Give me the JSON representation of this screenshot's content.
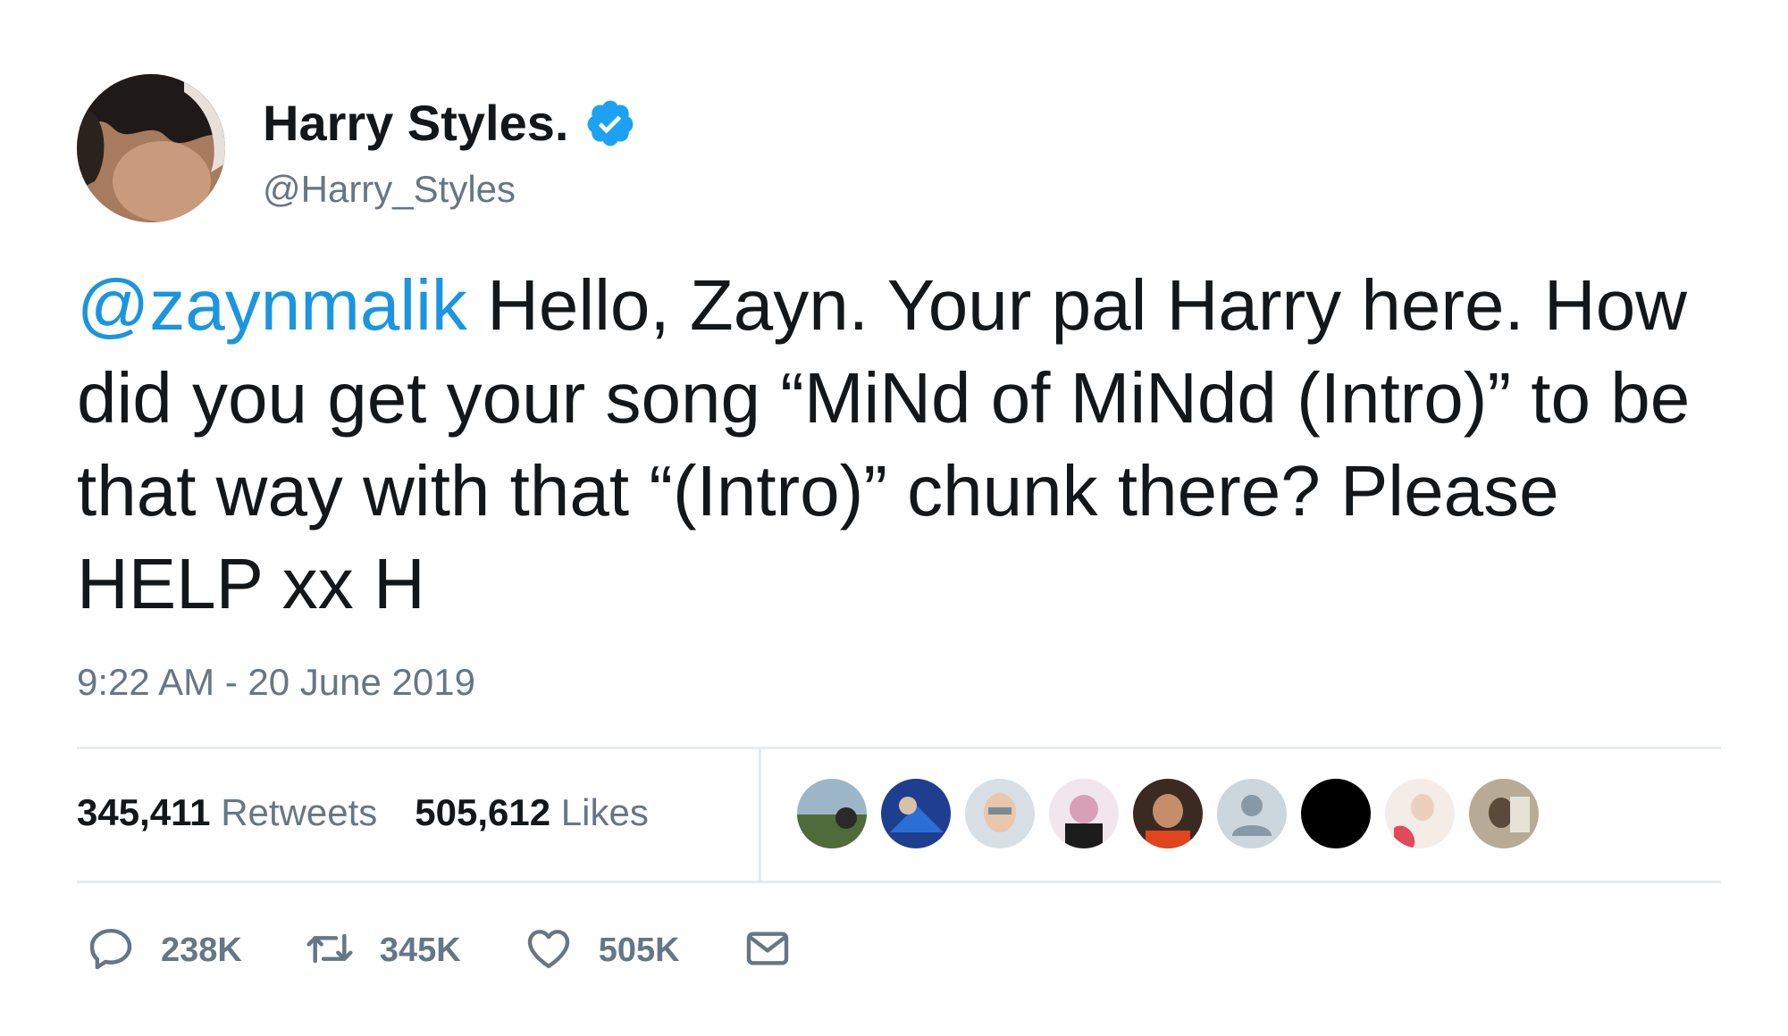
{
  "user": {
    "display_name": "Harry Styles.",
    "handle": "@Harry_Styles",
    "verified": true
  },
  "tweet": {
    "mention": "@zaynmalik",
    "body": " Hello, Zayn. Your pal Harry here. How did you get your song “MiNd of MiNdd (Intro)” to be that way with that “(Intro)” chunk there? Please HELP xx H",
    "timestamp": "9:22 AM - 20 June 2019"
  },
  "stats": {
    "retweets_count": "345,411",
    "retweets_label": "Retweets",
    "likes_count": "505,612",
    "likes_label": "Likes"
  },
  "actions": {
    "reply_count": "238K",
    "retweet_count": "345K",
    "like_count": "505K"
  },
  "colors": {
    "text": "#14171a",
    "secondary": "#657786",
    "link": "#1b95e0",
    "verified": "#1da1f2",
    "divider": "#e6ecf0"
  },
  "icons": [
    "verified-badge-icon",
    "reply-icon",
    "retweet-icon",
    "like-icon",
    "direct-message-icon"
  ]
}
